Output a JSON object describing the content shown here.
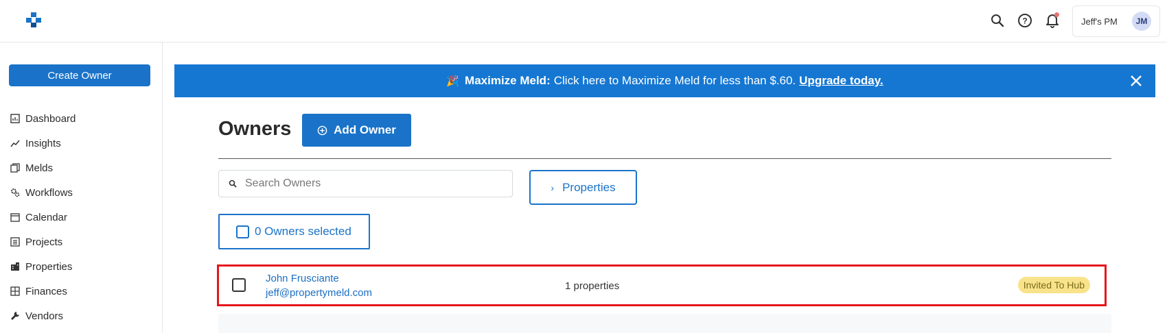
{
  "colors": {
    "primary": "#1a73c8",
    "banner": "#1577d2",
    "highlight": "#e5141b",
    "badge_bg": "#f9e38a"
  },
  "topbar": {
    "account_name": "Jeff's PM",
    "avatar_initials": "JM",
    "icons": [
      "search-icon",
      "help-icon",
      "bell-icon"
    ]
  },
  "sidebar": {
    "create_label": "Create Owner",
    "items": [
      {
        "label": "Dashboard",
        "icon": "dashboard-icon"
      },
      {
        "label": "Insights",
        "icon": "insights-icon"
      },
      {
        "label": "Melds",
        "icon": "melds-icon"
      },
      {
        "label": "Workflows",
        "icon": "workflows-icon"
      },
      {
        "label": "Calendar",
        "icon": "calendar-icon"
      },
      {
        "label": "Projects",
        "icon": "projects-icon"
      },
      {
        "label": "Properties",
        "icon": "properties-icon"
      },
      {
        "label": "Finances",
        "icon": "finances-icon"
      },
      {
        "label": "Vendors",
        "icon": "vendors-icon"
      }
    ]
  },
  "banner": {
    "emoji": "🎉",
    "bold": "Maximize Meld:",
    "text": "Click here to Maximize Meld for less than $.60.",
    "link": "Upgrade today."
  },
  "main": {
    "title": "Owners",
    "add_label": "Add Owner",
    "search_placeholder": "Search Owners",
    "properties_label": "Properties",
    "selected_label": "0 Owners selected",
    "owners": [
      {
        "name": "John Frusciante",
        "email": "jeff@propertymeld.com",
        "properties": "1 properties",
        "status": "Invited To Hub"
      }
    ]
  }
}
